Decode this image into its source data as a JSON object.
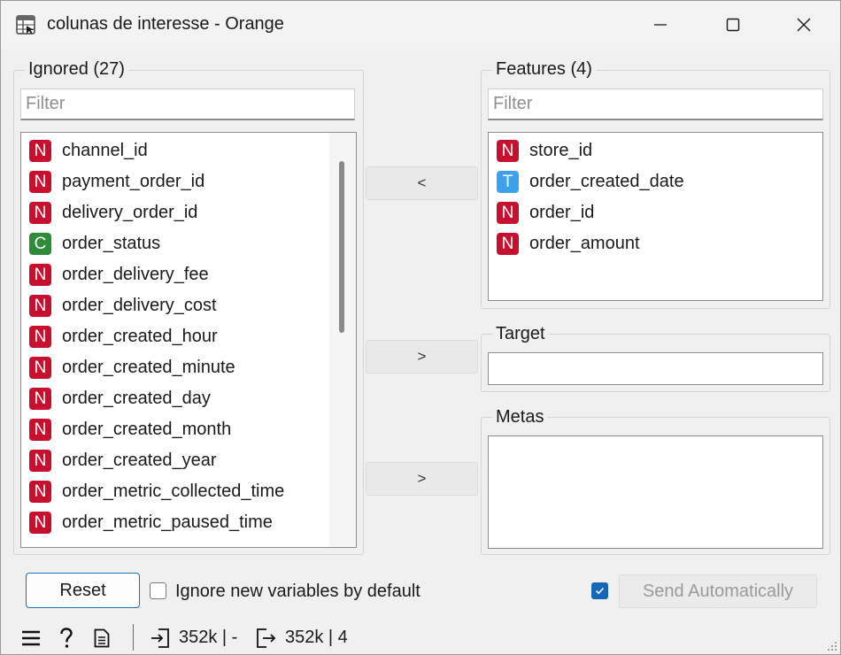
{
  "window": {
    "title": "colunas de interesse - Orange",
    "minimize_icon": "minimize-icon",
    "maximize_icon": "maximize-icon",
    "close_icon": "close-icon"
  },
  "ignored": {
    "title": "Ignored (27)",
    "filter_placeholder": "Filter",
    "filter_value": "",
    "items": [
      {
        "type": "N",
        "name": "channel_id"
      },
      {
        "type": "N",
        "name": "payment_order_id"
      },
      {
        "type": "N",
        "name": "delivery_order_id"
      },
      {
        "type": "C",
        "name": "order_status"
      },
      {
        "type": "N",
        "name": "order_delivery_fee"
      },
      {
        "type": "N",
        "name": "order_delivery_cost"
      },
      {
        "type": "N",
        "name": "order_created_hour"
      },
      {
        "type": "N",
        "name": "order_created_minute"
      },
      {
        "type": "N",
        "name": "order_created_day"
      },
      {
        "type": "N",
        "name": "order_created_month"
      },
      {
        "type": "N",
        "name": "order_created_year"
      },
      {
        "type": "N",
        "name": "order_metric_collected_time"
      },
      {
        "type": "N",
        "name": "order_metric_paused_time"
      }
    ]
  },
  "features": {
    "title": "Features (4)",
    "filter_placeholder": "Filter",
    "filter_value": "",
    "items": [
      {
        "type": "N",
        "name": "store_id"
      },
      {
        "type": "T",
        "name": "order_created_date"
      },
      {
        "type": "N",
        "name": "order_id"
      },
      {
        "type": "N",
        "name": "order_amount"
      }
    ]
  },
  "target": {
    "title": "Target"
  },
  "metas": {
    "title": "Metas"
  },
  "move_buttons": {
    "to_ignored": "<",
    "to_target": ">",
    "to_metas": ">"
  },
  "controls": {
    "reset_label": "Reset",
    "ignore_new_label": "Ignore new variables by default",
    "ignore_new_checked": false,
    "auto_send_checked": true,
    "send_label": "Send Automatically"
  },
  "statusbar": {
    "input_summary": "352k | -",
    "output_summary": "352k | 4"
  },
  "colors": {
    "numeric": "#c8102e",
    "categorical": "#2e8b3a",
    "time": "#3ca1ea",
    "accent": "#1667b8"
  }
}
